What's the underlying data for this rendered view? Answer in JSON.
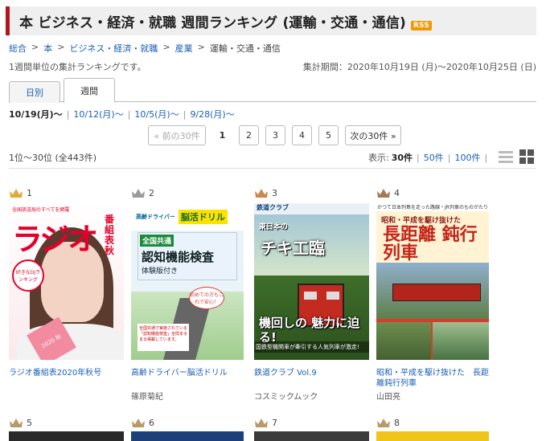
{
  "header": {
    "title": "本 ビジネス・経済・就職 週間ランキング (運輸・交通・通信)",
    "rss": "RSS"
  },
  "breadcrumb": [
    {
      "label": "総合",
      "link": true
    },
    {
      "label": "本",
      "link": true
    },
    {
      "label": "ビジネス・経済・就職",
      "link": true
    },
    {
      "label": "産業",
      "link": true
    },
    {
      "label": "運輸・交通・通信",
      "link": false
    }
  ],
  "breadcrumb_sep": ">",
  "description": "1週間単位の集計ランキングです。",
  "period": "集計期間：2020年10月19日 (月)～2020年10月25日 (日)",
  "tabs": [
    {
      "label": "日別"
    },
    {
      "label": "週間"
    }
  ],
  "weeks": [
    "10/19(月)～",
    "10/12(月)～",
    "10/5(月)～",
    "9/28(月)～"
  ],
  "week_sep": "|",
  "pager": {
    "prev": "« 前の30件",
    "current": "1",
    "pages": [
      "2",
      "3",
      "4",
      "5"
    ],
    "next": "次の30件 »"
  },
  "result_count": "1位～30位 (全443件)",
  "display": {
    "label": "表示:",
    "current": "30件",
    "options": [
      "50件",
      "100件"
    ],
    "sep": "|"
  },
  "items": [
    {
      "rank": "1",
      "title": "ラジオ番組表2020年秋号",
      "author": "",
      "crown": "#e0a93b",
      "cover": {
        "mast": "ラジオ",
        "side": "番組表 秋",
        "top": "全国放送局のすべてを網羅",
        "badge": "好きなDJランキング",
        "pink": "2020 秋"
      }
    },
    {
      "rank": "2",
      "title": "高齢ドライバー脳活ドリル",
      "author": "篠原菊紀",
      "crown": "#9a9a9a",
      "cover": {
        "hd1": "高齢ドライバー",
        "hd2": "脳活ドリル",
        "t1": "全国共通",
        "t2": "認知機能検査",
        "t3": "体験版付き",
        "sign": "初めての方もこれで安心！",
        "note": "全国共通で実施されている「認知機能検査」全問まるまる掲載しています。"
      }
    },
    {
      "rank": "3",
      "title": "鉄道クラブ Vol.9",
      "author": "コスミックムック",
      "crown": "#c8894a",
      "cover": {
        "hdr": "鉄道クラブ",
        "sub": "東日本の",
        "big": "チキ工臨",
        "tag": "機回しの 魅力に迫る!",
        "tag2": "国鉄型機関車が牽引する人気列車が激走!"
      }
    },
    {
      "rank": "4",
      "title": "昭和・平成を駆け抜けた　長距離鈍行列車",
      "author": "山田亮",
      "crown": "#a37a55",
      "cover": {
        "top": "かつて日本列島を走った路線・JR列車のものがたり",
        "small": "昭和・平成を駆け抜けた",
        "big": "長距離 鈍行列車"
      }
    }
  ],
  "row2_ranks": [
    "5",
    "6",
    "7",
    "8"
  ],
  "colors": {
    "accent": "#b4141c",
    "link": "#1a5fb4",
    "rss": "#f39800"
  }
}
